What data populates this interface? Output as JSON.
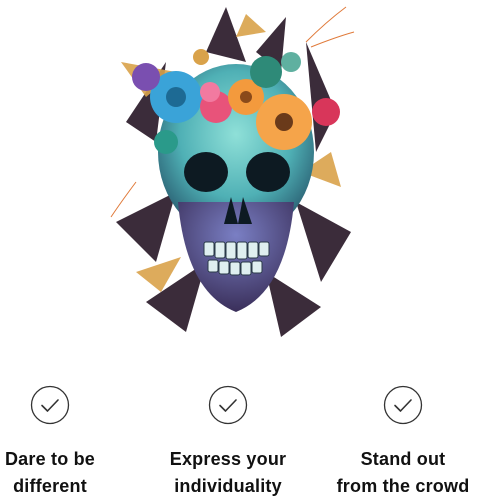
{
  "illustration": {
    "subject": "skull with flowers and leaves",
    "colors": {
      "skull": "#6fc7c4",
      "skull_shadow": "#2f6a78",
      "flower_orange": "#f39a3d",
      "flower_pink": "#e8537a",
      "flower_blue": "#3aa3d8",
      "leaf_dark": "#3b2c3a",
      "leaf_gold": "#d9a24a"
    }
  },
  "features": [
    {
      "icon": "check-circle-icon",
      "line1": "Dare to be",
      "line2": "different"
    },
    {
      "icon": "check-circle-icon",
      "line1": "Express your",
      "line2": "individuality"
    },
    {
      "icon": "check-circle-icon",
      "line1": "Stand out",
      "line2": "from the crowd"
    }
  ]
}
